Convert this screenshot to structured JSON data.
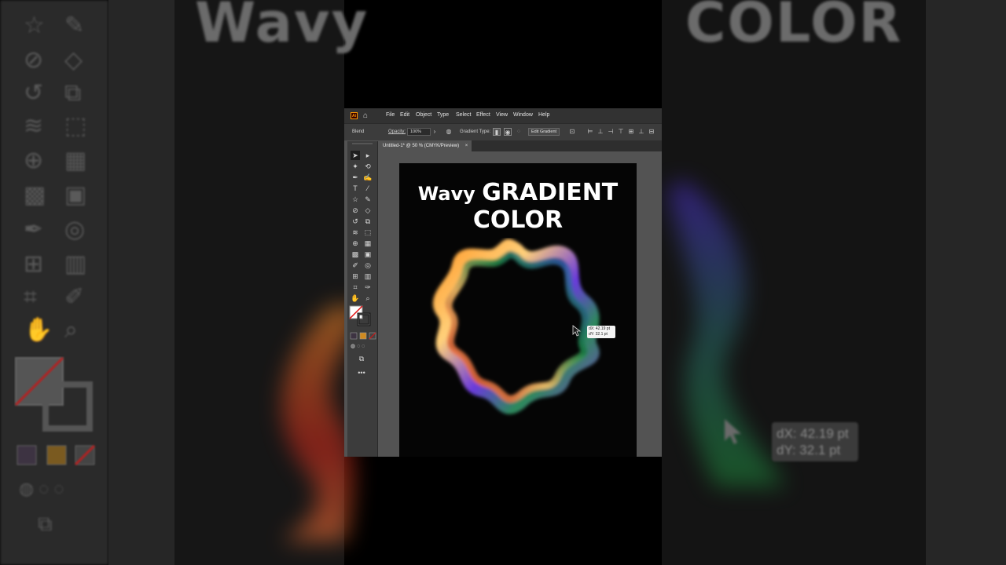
{
  "app": {
    "logo": "Ai",
    "menu": [
      "File",
      "Edit",
      "Object",
      "Type",
      "Select",
      "Effect",
      "View",
      "Window",
      "Help"
    ]
  },
  "controlbar": {
    "object_type": "Blend",
    "opacity_label": "Opacity:",
    "opacity_value": "100%",
    "gradient_type_label": "Gradient Type:",
    "edit_gradient_label": "Edit Gradient"
  },
  "document": {
    "tab_title": "Untitled-1* @ 50 % (CMYK/Preview)",
    "close_glyph": "×"
  },
  "artboard": {
    "headline_part1": "Wavy ",
    "headline_part2": "GRADIENT COLOR"
  },
  "readout": {
    "dx": "dX: 42.19 pt",
    "dy": "dY: 32.1 pt"
  },
  "background": {
    "word_left": "Wavy",
    "word_right": "COLOR"
  },
  "colors": {
    "menubar": "#323232",
    "controlbar": "#3c3c3c",
    "workspace": "#535353",
    "artboard": "#050505"
  }
}
